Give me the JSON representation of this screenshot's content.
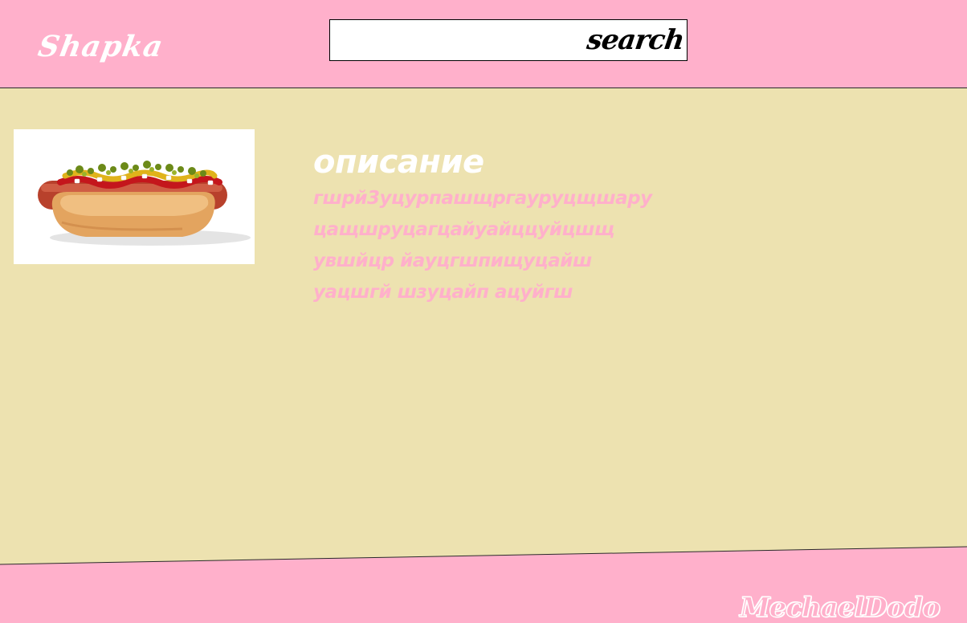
{
  "header": {
    "logo": "Shapka",
    "search": {
      "value": "",
      "placeholder": "",
      "label": "search"
    }
  },
  "main": {
    "image_icon": "hot-dog-image",
    "description": {
      "title": "описание",
      "lines": [
        "гшрй3уцурпашщргауруцщшару",
        "цащшруцагцайуайццуйцшщ",
        "увшйцр йауцгшпищуцайш",
        "уацшгй шзуцайп ацуйгш"
      ]
    }
  },
  "footer": {
    "signature": "MechaelDodo"
  },
  "colors": {
    "header_bg": "#ffb0cb",
    "content_bg": "#ede2b0",
    "accent_pink": "#ffb0cb",
    "text_white": "#ffffff"
  }
}
